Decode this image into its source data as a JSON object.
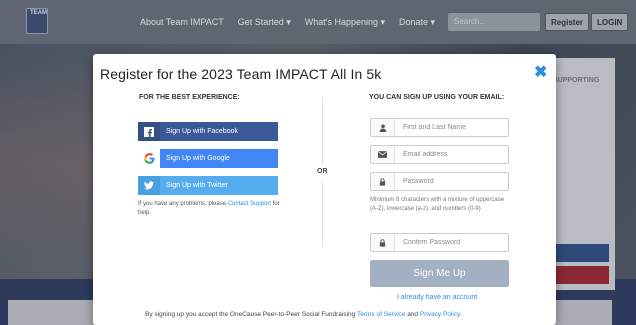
{
  "background": {
    "logo_text": "TEAM",
    "nav_links": [
      "About Team IMPACT",
      "Get Started ▾",
      "What's Happening ▾",
      "Donate ▾"
    ],
    "search_placeholder": "Search...",
    "register_label": "Register",
    "login_label": "LOGIN",
    "side_card_title": "SUPPORTING"
  },
  "modal": {
    "title": "Register for the 2023 Team IMPACT All In 5k",
    "left_heading": "FOR THE BEST EXPERIENCE:",
    "right_heading": "YOU CAN SIGN UP USING YOUR EMAIL:",
    "or_label": "OR",
    "social": {
      "facebook": "Sign Up with Facebook",
      "google": "Sign Up with Google",
      "twitter": "Sign Up with Twitter"
    },
    "help": {
      "prefix": "If you have any problems, please ",
      "link": "Contact Support",
      "suffix": " for help."
    },
    "fields": {
      "name_placeholder": "First and Last Name",
      "email_placeholder": "Email address",
      "password_placeholder": "Password",
      "confirm_placeholder": "Confirm Password"
    },
    "password_hint": "Minimum 8 characters with a mixture of uppercase (A-Z), lowercase (a-z), and numbers (0-9)",
    "signup_label": "Sign Me Up",
    "have_account": "I already have an account",
    "terms": {
      "prefix": "By signing up you accept the OneCause Peer-to-Peer Social Fundraising ",
      "tos": "Terms of Service",
      "and": " and ",
      "privacy": "Privacy Policy"
    }
  },
  "colors": {
    "facebook": "#3b5998",
    "google": "#4285f4",
    "twitter": "#55acee",
    "link": "#2c8fe0",
    "signup_button": "#a3b0c2"
  }
}
